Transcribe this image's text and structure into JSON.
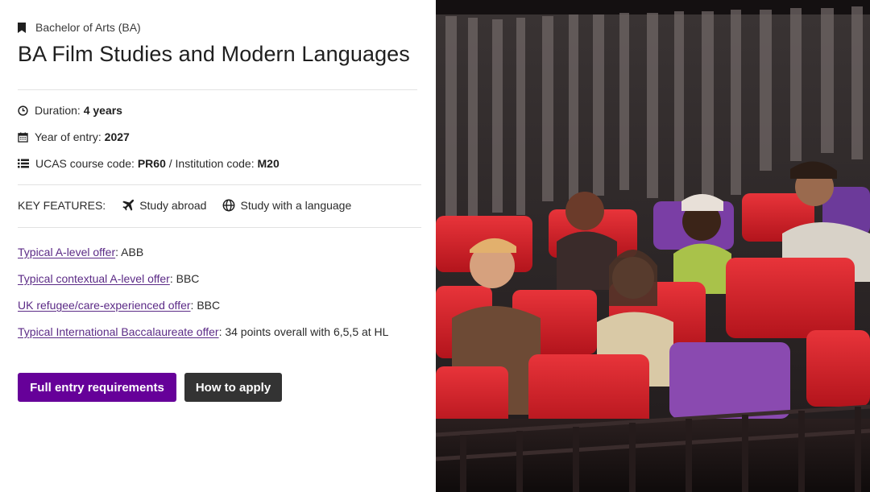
{
  "course": {
    "degree_type": "Bachelor of Arts (BA)",
    "title": "BA Film Studies and Modern Languages"
  },
  "info": {
    "duration_label": "Duration:",
    "duration_value": "4 years",
    "entry_label": "Year of entry:",
    "entry_value": "2027",
    "ucas_label": "UCAS course code:",
    "ucas_value": "PR60",
    "separator": "/",
    "institution_label": "Institution code:",
    "institution_value": "M20"
  },
  "features": {
    "label": "KEY FEATURES:",
    "items": [
      {
        "label": "Study abroad",
        "icon": "airplane-icon"
      },
      {
        "label": "Study with a language",
        "icon": "globe-icon"
      }
    ]
  },
  "offers": [
    {
      "link": "Typical A-level offer",
      "value": ": ABB"
    },
    {
      "link": "Typical contextual A-level offer",
      "value": ": BBC"
    },
    {
      "link": "UK refugee/care-experienced offer",
      "value": ": BBC"
    },
    {
      "link": "Typical International Baccalaureate offer",
      "value": ": 34 points overall with 6,5,5 at HL"
    }
  ],
  "buttons": {
    "entry_requirements": "Full entry requirements",
    "how_to_apply": "How to apply"
  },
  "colors": {
    "primary_purple": "#660099",
    "link_purple": "#5b2a86",
    "dark_button": "#333333",
    "seat_red": "#d8242b"
  },
  "image": {
    "description_icon": "cinema-audience-photo"
  }
}
